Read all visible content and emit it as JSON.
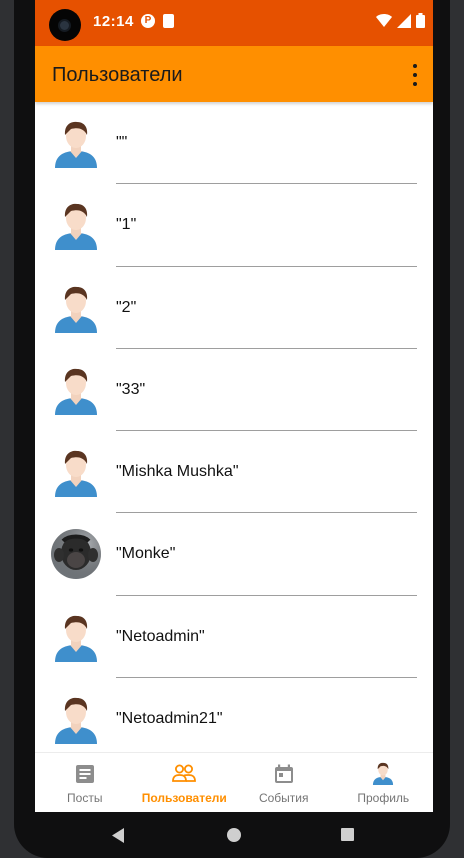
{
  "status_bar": {
    "time": "12:14",
    "icons": [
      "app-notification-icon",
      "sd-card-icon",
      "wifi-icon",
      "signal-icon",
      "battery-icon"
    ]
  },
  "app_bar": {
    "title": "Пользователи",
    "menu_icon": "more-vert-icon"
  },
  "colors": {
    "status_bar": "#e65100",
    "app_bar": "#ff8f00",
    "active_nav": "#ff8f00",
    "inactive_nav": "#757575"
  },
  "users": [
    {
      "name": "\"\"",
      "avatar": "default-user-avatar"
    },
    {
      "name": "\"1\"",
      "avatar": "default-user-avatar"
    },
    {
      "name": "\"2\"",
      "avatar": "default-user-avatar"
    },
    {
      "name": "\"33\"",
      "avatar": "default-user-avatar"
    },
    {
      "name": "\"Mishka Mushka\"",
      "avatar": "default-user-avatar"
    },
    {
      "name": "\"Monke\"",
      "avatar": "monkey-photo-avatar"
    },
    {
      "name": "\"Netoadmin\"",
      "avatar": "default-user-avatar"
    },
    {
      "name": "\"Netoadmin21\"",
      "avatar": "default-user-avatar"
    }
  ],
  "bottom_nav": {
    "items": [
      {
        "label": "Посты",
        "icon": "article-icon",
        "active": false
      },
      {
        "label": "Пользователи",
        "icon": "people-icon",
        "active": true
      },
      {
        "label": "События",
        "icon": "calendar-icon",
        "active": false
      },
      {
        "label": "Профиль",
        "icon": "profile-avatar-icon",
        "active": false
      }
    ]
  },
  "system_nav": {
    "icons": [
      "back-icon",
      "home-icon",
      "recents-icon"
    ]
  }
}
